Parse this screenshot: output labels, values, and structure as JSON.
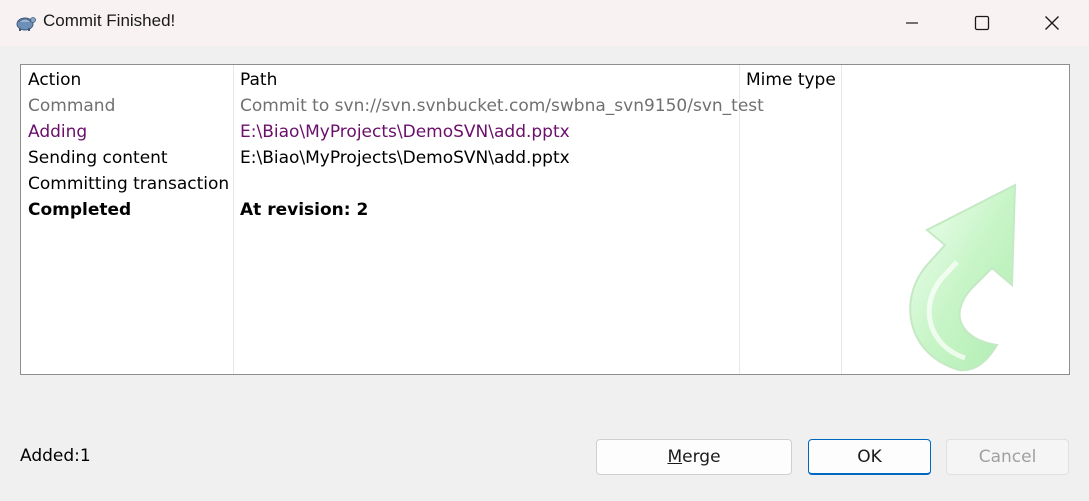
{
  "window": {
    "title": "Commit Finished!",
    "icon": "tortoise-svn-icon"
  },
  "list": {
    "columns": [
      "Action",
      "Path",
      "Mime type"
    ],
    "rows": [
      {
        "action": "Command",
        "path": "Commit to svn://svn.svnbucket.com/swbna_svn9150/svn_test",
        "style": "gray"
      },
      {
        "action": "Adding",
        "path": "E:\\Biao\\MyProjects\\DemoSVN\\add.pptx",
        "style": "purple"
      },
      {
        "action": "Sending content",
        "path": "E:\\Biao\\MyProjects\\DemoSVN\\add.pptx",
        "style": "normal"
      },
      {
        "action": "Committing transaction...",
        "path": "",
        "style": "normal"
      },
      {
        "action": "Completed",
        "path": "At revision: 2",
        "style": "bold"
      }
    ]
  },
  "status": {
    "text": "Added:1"
  },
  "buttons": {
    "merge_first": "M",
    "merge_rest": "erge",
    "ok": "OK",
    "cancel": "Cancel"
  },
  "colors": {
    "gray_text": "#707070",
    "purple_text": "#6a0f6a",
    "accent": "#0067c0",
    "arrow_green": "#7fe07f"
  }
}
